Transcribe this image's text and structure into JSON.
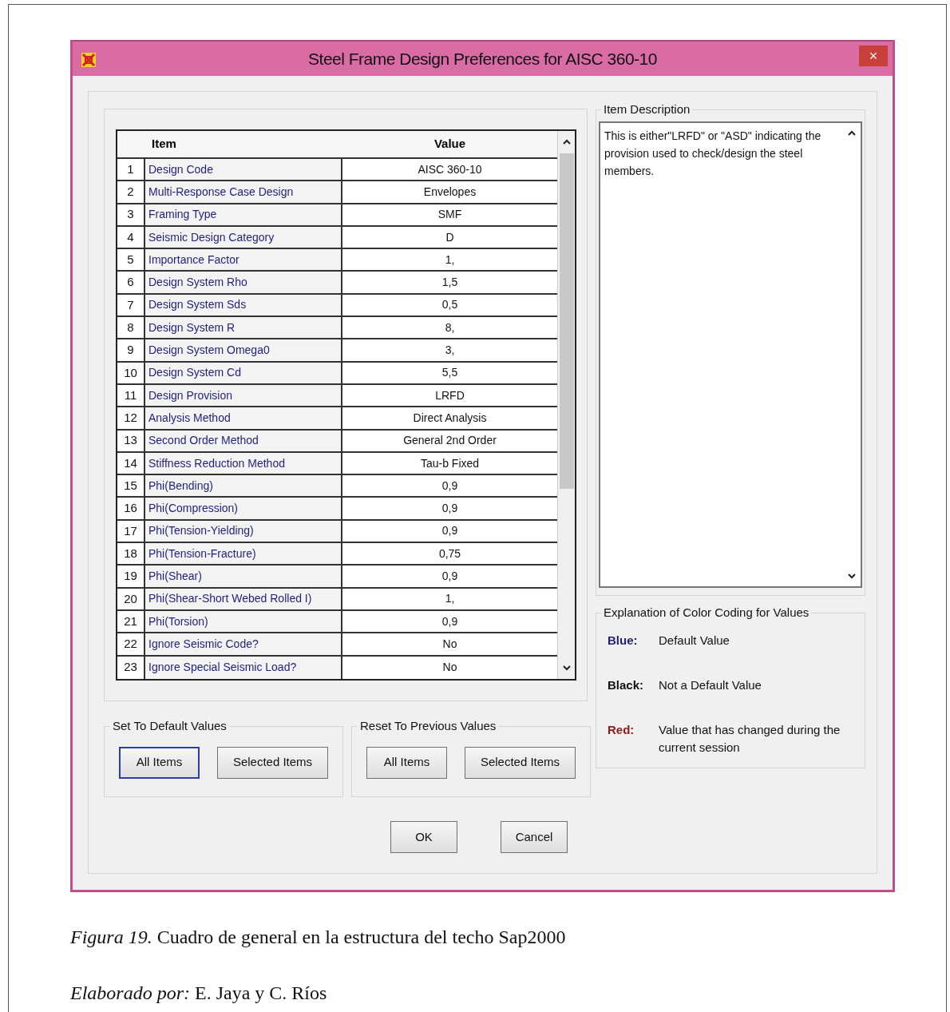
{
  "window": {
    "title": "Steel Frame Design Preferences for AISC 360-10",
    "close": "×"
  },
  "table": {
    "columns": [
      "Item",
      "Value"
    ],
    "rows": [
      {
        "number": "1",
        "item": "Design Code",
        "value": "AISC 360-10"
      },
      {
        "number": "2",
        "item": "Multi-Response Case Design",
        "value": "Envelopes"
      },
      {
        "number": "3",
        "item": "Framing Type",
        "value": "SMF"
      },
      {
        "number": "4",
        "item": "Seismic Design Category",
        "value": "D"
      },
      {
        "number": "5",
        "item": "Importance Factor",
        "value": "1,"
      },
      {
        "number": "6",
        "item": "Design System Rho",
        "value": "1,5"
      },
      {
        "number": "7",
        "item": "Design System Sds",
        "value": "0,5"
      },
      {
        "number": "8",
        "item": "Design System R",
        "value": "8,"
      },
      {
        "number": "9",
        "item": "Design System Omega0",
        "value": "3,"
      },
      {
        "number": "10",
        "item": "Design System Cd",
        "value": "5,5"
      },
      {
        "number": "11",
        "item": "Design Provision",
        "value": "LRFD"
      },
      {
        "number": "12",
        "item": "Analysis Method",
        "value": "Direct Analysis"
      },
      {
        "number": "13",
        "item": "Second Order Method",
        "value": "General 2nd Order"
      },
      {
        "number": "14",
        "item": "Stiffness Reduction Method",
        "value": "Tau-b Fixed"
      },
      {
        "number": "15",
        "item": "Phi(Bending)",
        "value": "0,9"
      },
      {
        "number": "16",
        "item": "Phi(Compression)",
        "value": "0,9"
      },
      {
        "number": "17",
        "item": "Phi(Tension-Yielding)",
        "value": "0,9"
      },
      {
        "number": "18",
        "item": "Phi(Tension-Fracture)",
        "value": "0,75"
      },
      {
        "number": "19",
        "item": "Phi(Shear)",
        "value": "0,9"
      },
      {
        "number": "20",
        "item": "Phi(Shear-Short Webed Rolled I)",
        "value": "1,"
      },
      {
        "number": "21",
        "item": "Phi(Torsion)",
        "value": "0,9"
      },
      {
        "number": "22",
        "item": "Ignore Seismic Code?",
        "value": "No"
      },
      {
        "number": "23",
        "item": "Ignore Special Seismic Load?",
        "value": "No"
      }
    ]
  },
  "item_description": {
    "label": "Item Description",
    "text": "This is either\"LRFD\" or \"ASD\" indicating the provision used to check/design the steel members."
  },
  "color_coding": {
    "label": "Explanation of Color Coding for Values",
    "entries": [
      {
        "name": "Blue:",
        "color": "#1f1f7a",
        "meaning": "Default Value"
      },
      {
        "name": "Black:",
        "color": "#111111",
        "meaning": "Not a Default Value"
      },
      {
        "name": "Red:",
        "color": "#8b1a1a",
        "meaning": "Value that has changed during the current session"
      }
    ]
  },
  "button_groups": [
    {
      "label": "Set To Default Values",
      "buttons": [
        {
          "label": "All Items",
          "focused": true
        },
        {
          "label": "Selected Items",
          "focused": false
        }
      ]
    },
    {
      "label": "Reset To Previous Values",
      "buttons": [
        {
          "label": "All Items",
          "focused": false
        },
        {
          "label": "Selected Items",
          "focused": false
        }
      ]
    }
  ],
  "dialog_buttons": [
    "OK",
    "Cancel"
  ],
  "caption": [
    "*Figura 19.* Cuadro de general en la estructura del techo Sap2000",
    "*Elaborado por:* E. Jaya y C. Ríos"
  ]
}
